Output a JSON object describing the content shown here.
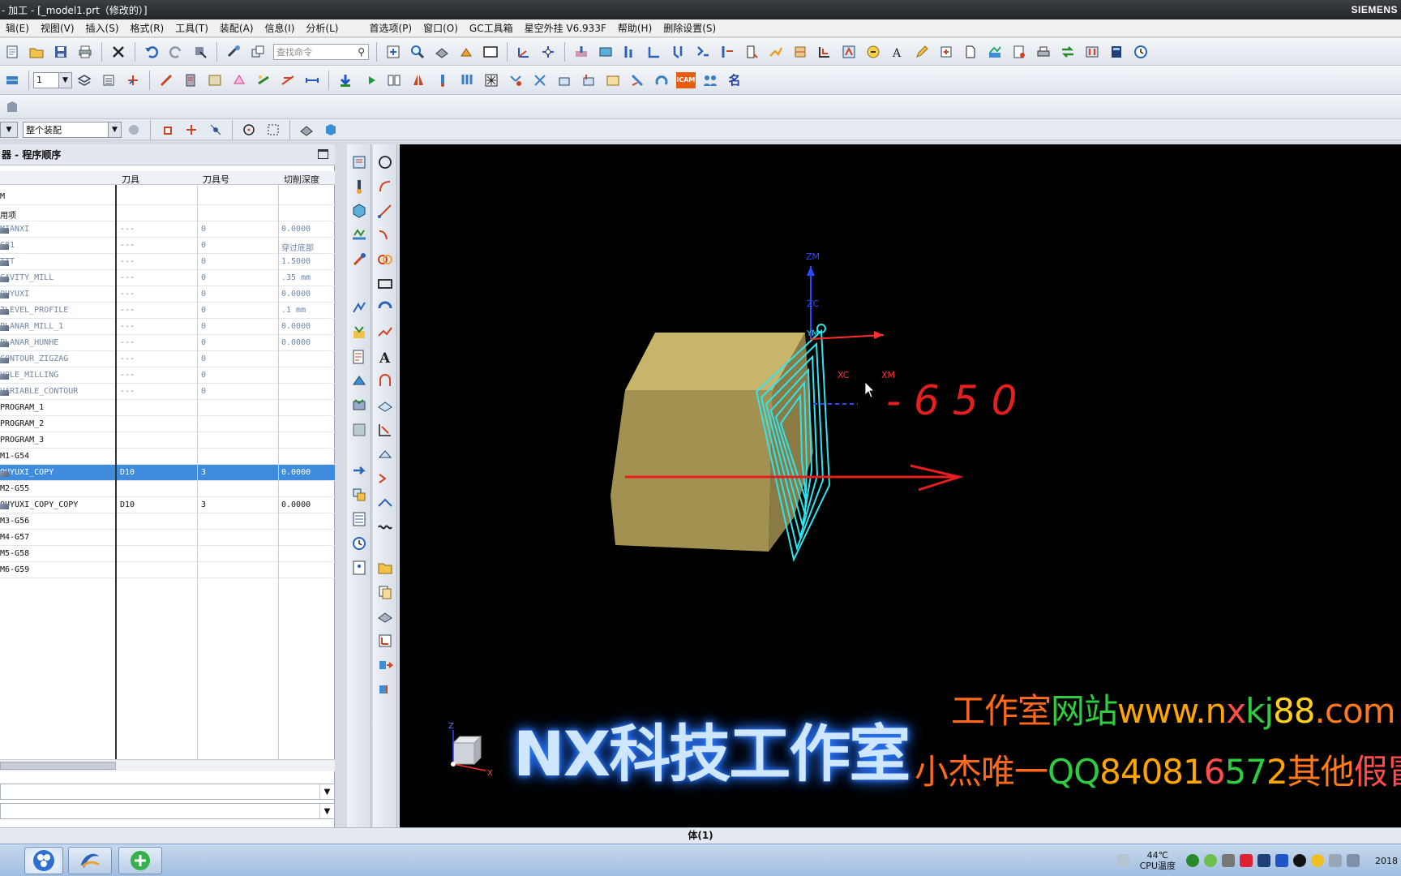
{
  "window": {
    "title": "- 加工 - [_model1.prt（修改的）]",
    "brand": "SIEMENS"
  },
  "menu": {
    "items": [
      "辑(E)",
      "视图(V)",
      "插入(S)",
      "格式(R)",
      "工具(T)",
      "装配(A)",
      "信息(I)",
      "分析(L)"
    ],
    "items2": [
      "首选项(P)",
      "窗口(O)",
      "GC工具箱",
      "星空外挂 V6.933F",
      "帮助(H)",
      "删除设置(S)"
    ]
  },
  "toolbar": {
    "search_placeholder": "查找命令",
    "layer_value": "1",
    "selection_filter": "整个装配",
    "icam_label": "iCAM",
    "name_label": "名"
  },
  "navigator": {
    "title": "器 - 程序顺序",
    "columns": [
      "刀具",
      "刀具号",
      "切削深度"
    ],
    "rows": [
      {
        "name": "M",
        "tool": "",
        "num": "",
        "depth": "",
        "muted": false,
        "icon": false
      },
      {
        "name": "用项",
        "tool": "",
        "num": "",
        "depth": "",
        "muted": false,
        "icon": false
      },
      {
        "name": "MIANXI",
        "tool": "---",
        "num": "0",
        "depth": "0.0000",
        "muted": true,
        "icon": true
      },
      {
        "name": "G81",
        "tool": "---",
        "num": "0",
        "depth": "穿过底部",
        "muted": true,
        "icon": true
      },
      {
        "name": "TTT",
        "tool": "---",
        "num": "0",
        "depth": "1.5000",
        "muted": true,
        "icon": true
      },
      {
        "name": "CAVITY_MILL",
        "tool": "---",
        "num": "0",
        "depth": ".35 mm",
        "muted": true,
        "icon": true
      },
      {
        "name": "QUYUXI",
        "tool": "---",
        "num": "0",
        "depth": "0.0000",
        "muted": true,
        "icon": true
      },
      {
        "name": "ZLEVEL_PROFILE",
        "tool": "---",
        "num": "0",
        "depth": ".1 mm",
        "muted": true,
        "icon": true
      },
      {
        "name": "PLANAR_MILL_1",
        "tool": "---",
        "num": "0",
        "depth": "0.0000",
        "muted": true,
        "icon": true
      },
      {
        "name": "PLANAR_HUNHE",
        "tool": "---",
        "num": "0",
        "depth": "0.0000",
        "muted": true,
        "icon": true
      },
      {
        "name": "CONTOUR_ZIGZAG",
        "tool": "---",
        "num": "0",
        "depth": "",
        "muted": true,
        "icon": true
      },
      {
        "name": "HOLE_MILLING",
        "tool": "---",
        "num": "0",
        "depth": "",
        "muted": true,
        "icon": true
      },
      {
        "name": "VARIABLE_CONTOUR",
        "tool": "---",
        "num": "0",
        "depth": "",
        "muted": true,
        "icon": true
      },
      {
        "name": "PROGRAM_1",
        "tool": "",
        "num": "",
        "depth": "",
        "muted": false,
        "icon": false
      },
      {
        "name": "PROGRAM_2",
        "tool": "",
        "num": "",
        "depth": "",
        "muted": false,
        "icon": false
      },
      {
        "name": "PROGRAM_3",
        "tool": "",
        "num": "",
        "depth": "",
        "muted": false,
        "icon": false
      },
      {
        "name": "M1-G54",
        "tool": "",
        "num": "",
        "depth": "",
        "muted": false,
        "icon": false
      },
      {
        "name": "QUYUXI_COPY",
        "tool": "D10",
        "num": "3",
        "depth": "0.0000",
        "muted": false,
        "icon": true,
        "selected": true
      },
      {
        "name": "M2-G55",
        "tool": "",
        "num": "",
        "depth": "",
        "muted": false,
        "icon": false
      },
      {
        "name": "QUYUXI_COPY_COPY",
        "tool": "D10",
        "num": "3",
        "depth": "0.0000",
        "muted": false,
        "icon": true
      },
      {
        "name": "M3-G56",
        "tool": "",
        "num": "",
        "depth": "",
        "muted": false,
        "icon": false
      },
      {
        "name": "M4-G57",
        "tool": "",
        "num": "",
        "depth": "",
        "muted": false,
        "icon": false
      },
      {
        "name": "M5-G58",
        "tool": "",
        "num": "",
        "depth": "",
        "muted": false,
        "icon": false
      },
      {
        "name": "M6-G59",
        "tool": "",
        "num": "",
        "depth": "",
        "muted": false,
        "icon": false
      }
    ]
  },
  "viewport": {
    "axis_labels": {
      "zm": "ZM",
      "zc": "ZC",
      "ym": "YM",
      "xc": "XC",
      "xm": "XM"
    },
    "triad_labels": {
      "z": "Z",
      "x": "X"
    },
    "handwriting": "-650",
    "watermark_main": "NX科技工作室",
    "watermark_line1": [
      {
        "t": "工作室",
        "c": "#ff6a1a"
      },
      {
        "t": "网站",
        "c": "#2ecc40"
      },
      {
        "t": "www.n",
        "c": "#ffa500"
      },
      {
        "t": "x",
        "c": "#ff4d4d"
      },
      {
        "t": "kj",
        "c": "#2ecc40"
      },
      {
        "t": "88",
        "c": "#ffd11a"
      },
      {
        "t": ".com",
        "c": "#ff7a1a"
      }
    ],
    "watermark_line2": [
      {
        "t": "小杰唯一",
        "c": "#ff6a1a"
      },
      {
        "t": "QQ",
        "c": "#2ecc40"
      },
      {
        "t": "84081",
        "c": "#ffa500"
      },
      {
        "t": "6",
        "c": "#ff4d4d"
      },
      {
        "t": "57",
        "c": "#2ecc40"
      },
      {
        "t": "2",
        "c": "#ffa500"
      },
      {
        "t": "其他",
        "c": "#ff7a1a"
      },
      {
        "t": "假冒",
        "c": "#ff4d4d"
      }
    ]
  },
  "status": {
    "text": "体(1)"
  },
  "taskbar": {
    "cpu_temp": "44℃",
    "cpu_label": "CPU温度",
    "clock": "2018"
  }
}
